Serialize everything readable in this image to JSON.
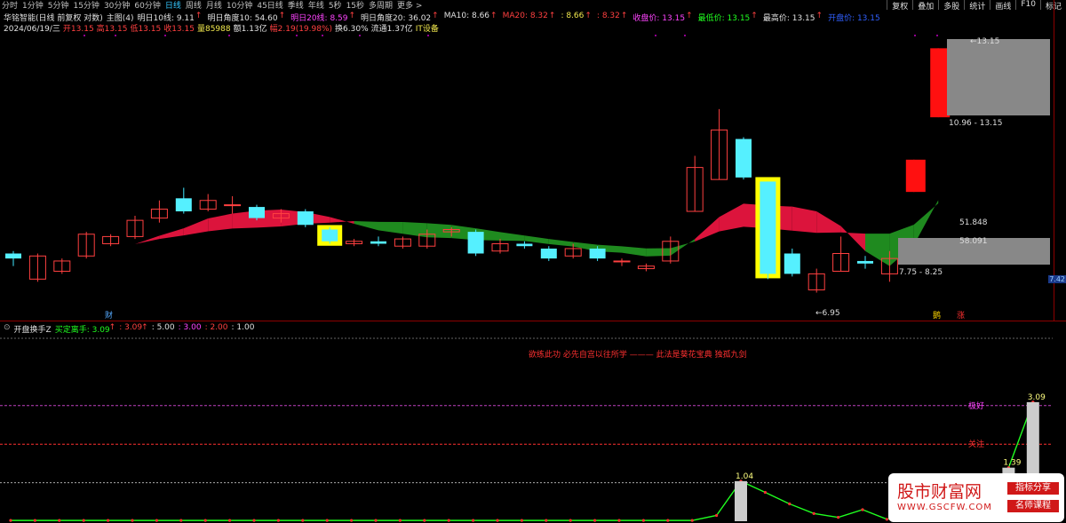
{
  "toolbar": {
    "periods": [
      "分时",
      "1分钟",
      "5分钟",
      "15分钟",
      "30分钟",
      "60分钟",
      "日线",
      "周线",
      "月线",
      "10分钟",
      "45日线",
      "季线",
      "年线",
      "5秒",
      "15秒",
      "多周期",
      "更多 >"
    ],
    "active": "日线",
    "right_buttons": [
      "复权",
      "叠加",
      "多股",
      "统计",
      "画线",
      "F10",
      "标记"
    ]
  },
  "header": {
    "stock": "华铭智能(日线 前复权 对数)",
    "main_label": "主图(4)",
    "items": [
      {
        "t": "明日10线: 9.11",
        "c": "w",
        "arrow": "↑"
      },
      {
        "t": "明日角度10: 54.60",
        "c": "w",
        "arrow": "↑"
      },
      {
        "t": "明日20线: 8.59",
        "c": "m",
        "arrow": "↑"
      },
      {
        "t": "明日角度20: 36.02",
        "c": "w",
        "arrow": "↑"
      },
      {
        "t": "MA10: 8.66",
        "c": "w",
        "arrow": "↑"
      },
      {
        "t": "MA20: 8.32",
        "c": "r",
        "arrow": "↑"
      },
      {
        "t": ": 8.66",
        "c": "y",
        "arrow": "↑"
      },
      {
        "t": ": 8.32",
        "c": "r",
        "arrow": "↑"
      },
      {
        "t": "收盘价: 13.15",
        "c": "m",
        "arrow": "↑"
      },
      {
        "t": "最低价: 13.15",
        "c": "g",
        "arrow": "↑"
      },
      {
        "t": "最高价: 13.15",
        "c": "w",
        "arrow": "↑"
      },
      {
        "t": "开盘价: 13.15",
        "c": "b",
        "arrow": ""
      }
    ]
  },
  "ohlc": {
    "date": "2024/06/19/三",
    "open": "开13.15",
    "high": "高13.15",
    "low": "低13.15",
    "close": "收13.15",
    "vol": "量85988",
    "amount": "额1.13亿",
    "change": "幅2.19(19.98%)",
    "turnover": "换6.30%",
    "float": "流通1.37亿",
    "sector": "IT设备"
  },
  "price_labels": {
    "top": "13.15",
    "range_high": "10.96 - 13.15",
    "v1": "51.848",
    "v2": "58.091",
    "range_low": "7.75 - 8.25",
    "low_mark": "←6.95",
    "current": "7.42",
    "tag_cai": "财",
    "tag_zhang": "涨",
    "tag_jing": "鹅"
  },
  "indicator": {
    "name": "开盘换手Z",
    "items": [
      {
        "t": "买定离手: 3.09",
        "c": "g",
        "arrow": "↑"
      },
      {
        "t": ": 3.09",
        "c": "r",
        "arrow": "↑"
      },
      {
        "t": ": 5.00",
        "c": "w",
        "arrow": ""
      },
      {
        "t": ": 3.00",
        "c": "m",
        "arrow": ""
      },
      {
        "t": ": 2.00",
        "c": "r",
        "arrow": ""
      },
      {
        "t": ": 1.00",
        "c": "w",
        "arrow": ""
      }
    ],
    "quote": "欲练此功 必先自宫以往所学 ——— 此法是葵花宝典 独孤九剑",
    "bar_labels": [
      "1.04",
      "1.39",
      "3.09"
    ],
    "line_labels": [
      "极好",
      "关注"
    ]
  },
  "watermark": {
    "title": "股市财富网",
    "url": "WWW.GSCFW.COM",
    "tag1": "指标分享",
    "tag2": "名师课程"
  },
  "chart_data": {
    "type": "candlestick",
    "candles": [
      {
        "o": 7.65,
        "c": 7.55,
        "h": 7.7,
        "l": 7.4
      },
      {
        "o": 7.15,
        "c": 7.6,
        "h": 7.65,
        "l": 7.1
      },
      {
        "o": 7.3,
        "c": 7.5,
        "h": 7.55,
        "l": 7.25
      },
      {
        "o": 7.6,
        "c": 8.05,
        "h": 8.1,
        "l": 7.55
      },
      {
        "o": 7.85,
        "c": 8.0,
        "h": 8.05,
        "l": 7.8
      },
      {
        "o": 8.0,
        "c": 8.35,
        "h": 8.45,
        "l": 7.95
      },
      {
        "o": 8.4,
        "c": 8.6,
        "h": 8.8,
        "l": 8.3
      },
      {
        "o": 8.85,
        "c": 8.55,
        "h": 9.1,
        "l": 8.5
      },
      {
        "o": 8.6,
        "c": 8.8,
        "h": 8.95,
        "l": 8.55
      },
      {
        "o": 8.7,
        "c": 8.7,
        "h": 8.9,
        "l": 8.5
      },
      {
        "o": 8.65,
        "c": 8.4,
        "h": 8.7,
        "l": 8.35
      },
      {
        "o": 8.4,
        "c": 8.5,
        "h": 8.6,
        "l": 8.3
      },
      {
        "o": 8.55,
        "c": 8.25,
        "h": 8.6,
        "l": 8.2
      },
      {
        "o": 8.15,
        "c": 7.9,
        "h": 8.2,
        "l": 7.85
      },
      {
        "o": 7.85,
        "c": 7.9,
        "h": 7.95,
        "l": 7.8
      },
      {
        "o": 7.9,
        "c": 7.85,
        "h": 8.0,
        "l": 7.8
      },
      {
        "o": 7.8,
        "c": 7.95,
        "h": 8.0,
        "l": 7.75
      },
      {
        "o": 7.8,
        "c": 8.05,
        "h": 8.15,
        "l": 7.75
      },
      {
        "o": 8.1,
        "c": 8.15,
        "h": 8.2,
        "l": 8.0
      },
      {
        "o": 8.1,
        "c": 7.65,
        "h": 8.15,
        "l": 7.6
      },
      {
        "o": 7.7,
        "c": 7.85,
        "h": 7.95,
        "l": 7.65
      },
      {
        "o": 7.85,
        "c": 7.8,
        "h": 7.9,
        "l": 7.75
      },
      {
        "o": 7.75,
        "c": 7.55,
        "h": 7.8,
        "l": 7.5
      },
      {
        "o": 7.6,
        "c": 7.75,
        "h": 7.85,
        "l": 7.55
      },
      {
        "o": 7.75,
        "c": 7.55,
        "h": 7.8,
        "l": 7.5
      },
      {
        "o": 7.5,
        "c": 7.5,
        "h": 7.55,
        "l": 7.4
      },
      {
        "o": 7.35,
        "c": 7.4,
        "h": 7.45,
        "l": 7.3
      },
      {
        "o": 7.5,
        "c": 7.9,
        "h": 8.0,
        "l": 7.45
      },
      {
        "o": 8.55,
        "c": 9.6,
        "h": 9.9,
        "l": 8.55
      },
      {
        "o": 9.3,
        "c": 10.6,
        "h": 11.2,
        "l": 9.3
      },
      {
        "o": 10.35,
        "c": 9.35,
        "h": 10.4,
        "l": 9.3
      },
      {
        "o": 9.25,
        "c": 7.25,
        "h": 9.25,
        "l": 7.15
      },
      {
        "o": 7.65,
        "c": 7.25,
        "h": 7.75,
        "l": 7.2
      },
      {
        "o": 6.95,
        "c": 7.25,
        "h": 7.35,
        "l": 6.9
      },
      {
        "o": 7.3,
        "c": 7.65,
        "h": 8.0,
        "l": 7.3
      },
      {
        "o": 7.5,
        "c": 7.45,
        "h": 7.6,
        "l": 7.35
      },
      {
        "o": 7.25,
        "c": 7.55,
        "h": 7.7,
        "l": 7.1
      },
      {
        "o": 9.0,
        "c": 9.8,
        "h": 9.8,
        "l": 9.0
      },
      {
        "o": 10.96,
        "c": 13.15,
        "h": 13.15,
        "l": 10.96
      }
    ],
    "highlight_index": [
      13,
      31
    ],
    "indicator_values": [
      0.02,
      0.02,
      0.02,
      0.02,
      0.02,
      0.02,
      0.02,
      0.02,
      0.02,
      0.02,
      0.02,
      0.02,
      0.02,
      0.02,
      0.02,
      0.02,
      0.02,
      0.02,
      0.02,
      0.02,
      0.02,
      0.02,
      0.02,
      0.02,
      0.02,
      0.02,
      0.02,
      0.02,
      0.02,
      0.15,
      1.04,
      0.75,
      0.45,
      0.2,
      0.1,
      0.3,
      0.05,
      0.2,
      0.05,
      0.1,
      0.05,
      1.39,
      3.09
    ],
    "levels": {
      "top": 5.0,
      "magenta": 3.0,
      "red": 2.0,
      "white": 1.0
    }
  }
}
